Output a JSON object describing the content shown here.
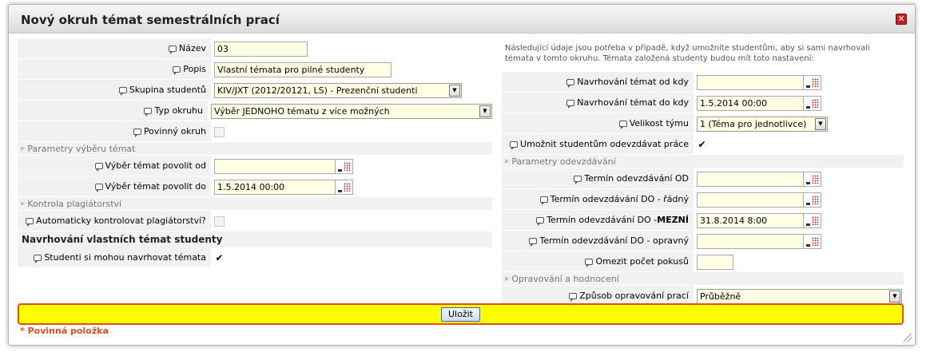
{
  "dialog": {
    "title": "Nový okruh témat semestrálních prací",
    "close_icon": "close-icon"
  },
  "left": {
    "nazev": {
      "label": "Název",
      "value": "03"
    },
    "popis": {
      "label": "Popis",
      "value": "Vlastní témata pro pilné studenty"
    },
    "skupina": {
      "label": "Skupina studentů",
      "value": "KIV/JXT (2012/20121, LS) - Prezenční studenti"
    },
    "typ": {
      "label": "Typ okruhu",
      "value": "Výběr JEDNOHO tématu z více možných"
    },
    "povinny": {
      "label": "Povinný okruh",
      "checked": false
    },
    "section_vyber": "Parametry výběru témat",
    "vyber_od": {
      "label": "Výběr témat povolit od",
      "value": ""
    },
    "vyber_do": {
      "label": "Výběr témat povolit do",
      "value": "1.5.2014 00:00"
    },
    "section_plagiat": "Kontrola plagiátorství",
    "auto_plagiat": {
      "label": "Automaticky kontrolovat plagiátorství?",
      "checked": false
    },
    "section_navrh": "Navrhování vlastních témat studenty",
    "studenti_navrh": {
      "label": "Studenti si mohou navrhovat témata",
      "checked": true
    }
  },
  "right": {
    "note": "Následující údaje jsou potřeba v případě, když umožníte studentům, aby si sami navrhovali témata v tomto okruhu. Témata založená studenty budou mít toto nastavení:",
    "navrh_od": {
      "label": "Navrhování témat od kdy",
      "value": ""
    },
    "navrh_do": {
      "label": "Navrhování témat do kdy",
      "value": "1.5.2014 00:00"
    },
    "velikost": {
      "label": "Velikost týmu",
      "value": "1 (Téma pro jednotlivce)"
    },
    "odevzdavat": {
      "label": "Umožnit studentům odevzdávat práce",
      "checked": true
    },
    "section_odevzd": "Parametry odevzdávání",
    "termin_od": {
      "label": "Termín odevzdávání OD",
      "value": ""
    },
    "termin_do_radny": {
      "label": "Termín odevzdávání DO - řádný",
      "value": ""
    },
    "termin_do_mezni": {
      "label_prefix": "Termín odevzdávání DO - ",
      "label_bold": "MEZNÍ",
      "value": "31.8.2014 8:00"
    },
    "termin_do_opravny": {
      "label": "Termín odevzdávání DO - opravný",
      "value": ""
    },
    "omezit": {
      "label": "Omezit počet pokusů",
      "value": ""
    },
    "section_oprav": "Opravování a hodnocení",
    "zpusob": {
      "label": "Způsob opravování prací",
      "value": "Průběžně"
    }
  },
  "footer": {
    "save_label": "Uložit",
    "required_note": "* Povinná položka"
  },
  "colors": {
    "input_bg": "#ffffe6",
    "savebar_bg": "#ffff00",
    "savebar_border": "#e0501e",
    "label_bg": "#f1f1f1"
  }
}
